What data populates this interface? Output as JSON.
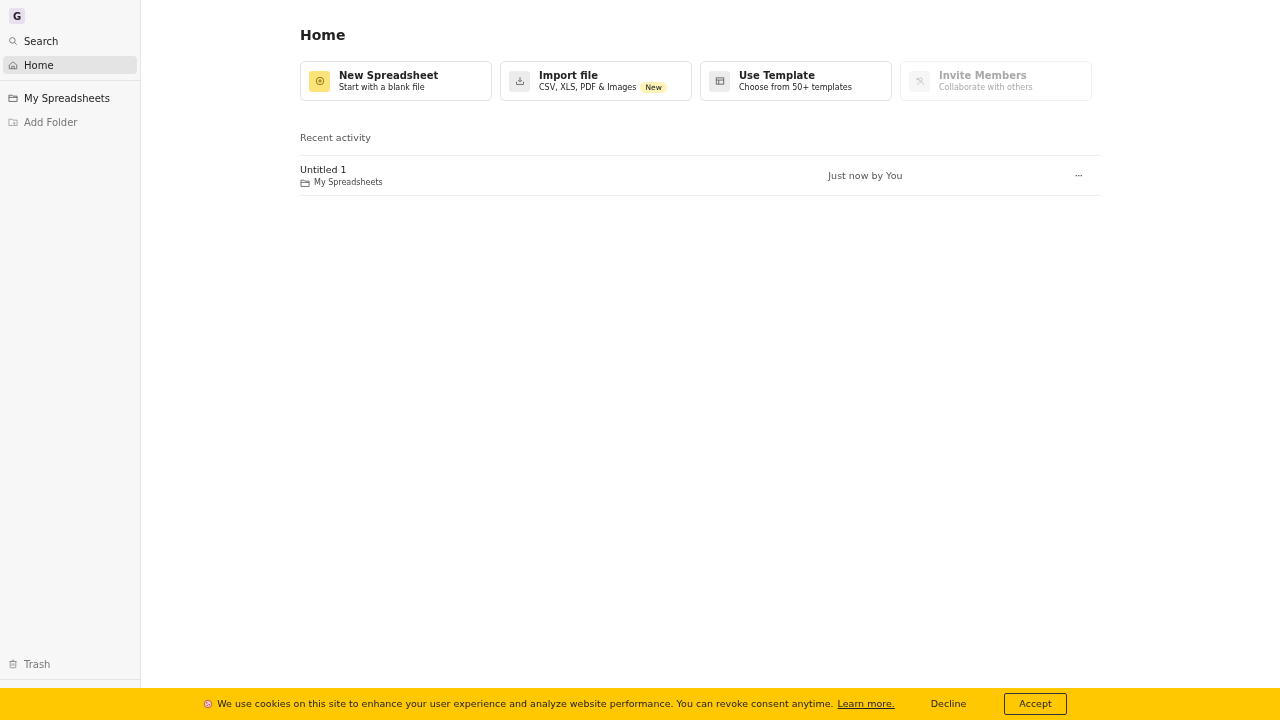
{
  "sidebar": {
    "workspace_initial": "G",
    "items": [
      {
        "label": "Search",
        "selected": false
      },
      {
        "label": "Home",
        "selected": true
      }
    ],
    "folders": [
      {
        "label": "My Spreadsheets",
        "muted": false
      },
      {
        "label": "Add Folder",
        "muted": true
      }
    ],
    "bottom_items": [
      {
        "label": "Trash"
      }
    ]
  },
  "page_title": "Home",
  "actions": [
    {
      "title": "New Spreadsheet",
      "subtitle": "Start with a blank file",
      "highlighted": true,
      "disabled": false
    },
    {
      "title": "Import file",
      "subtitle": "CSV, XLS, PDF & Images",
      "badge": "New",
      "highlighted": false,
      "disabled": false
    },
    {
      "title": "Use Template",
      "subtitle": "Choose from 50+ templates",
      "highlighted": false,
      "disabled": false
    },
    {
      "title": "Invite Members",
      "subtitle": "Collaborate with others",
      "highlighted": false,
      "disabled": true
    }
  ],
  "recent": {
    "heading": "Recent activity",
    "rows": [
      {
        "name": "Untitled 1",
        "folder": "My Spreadsheets",
        "time": "Just now by You",
        "menu": "···"
      }
    ]
  },
  "cookie_banner": {
    "message": "We use cookies on this site to enhance your user experience and analyze website performance. You can revoke consent anytime.",
    "link": "Learn more.",
    "decline": "Decline",
    "accept": "Accept"
  }
}
